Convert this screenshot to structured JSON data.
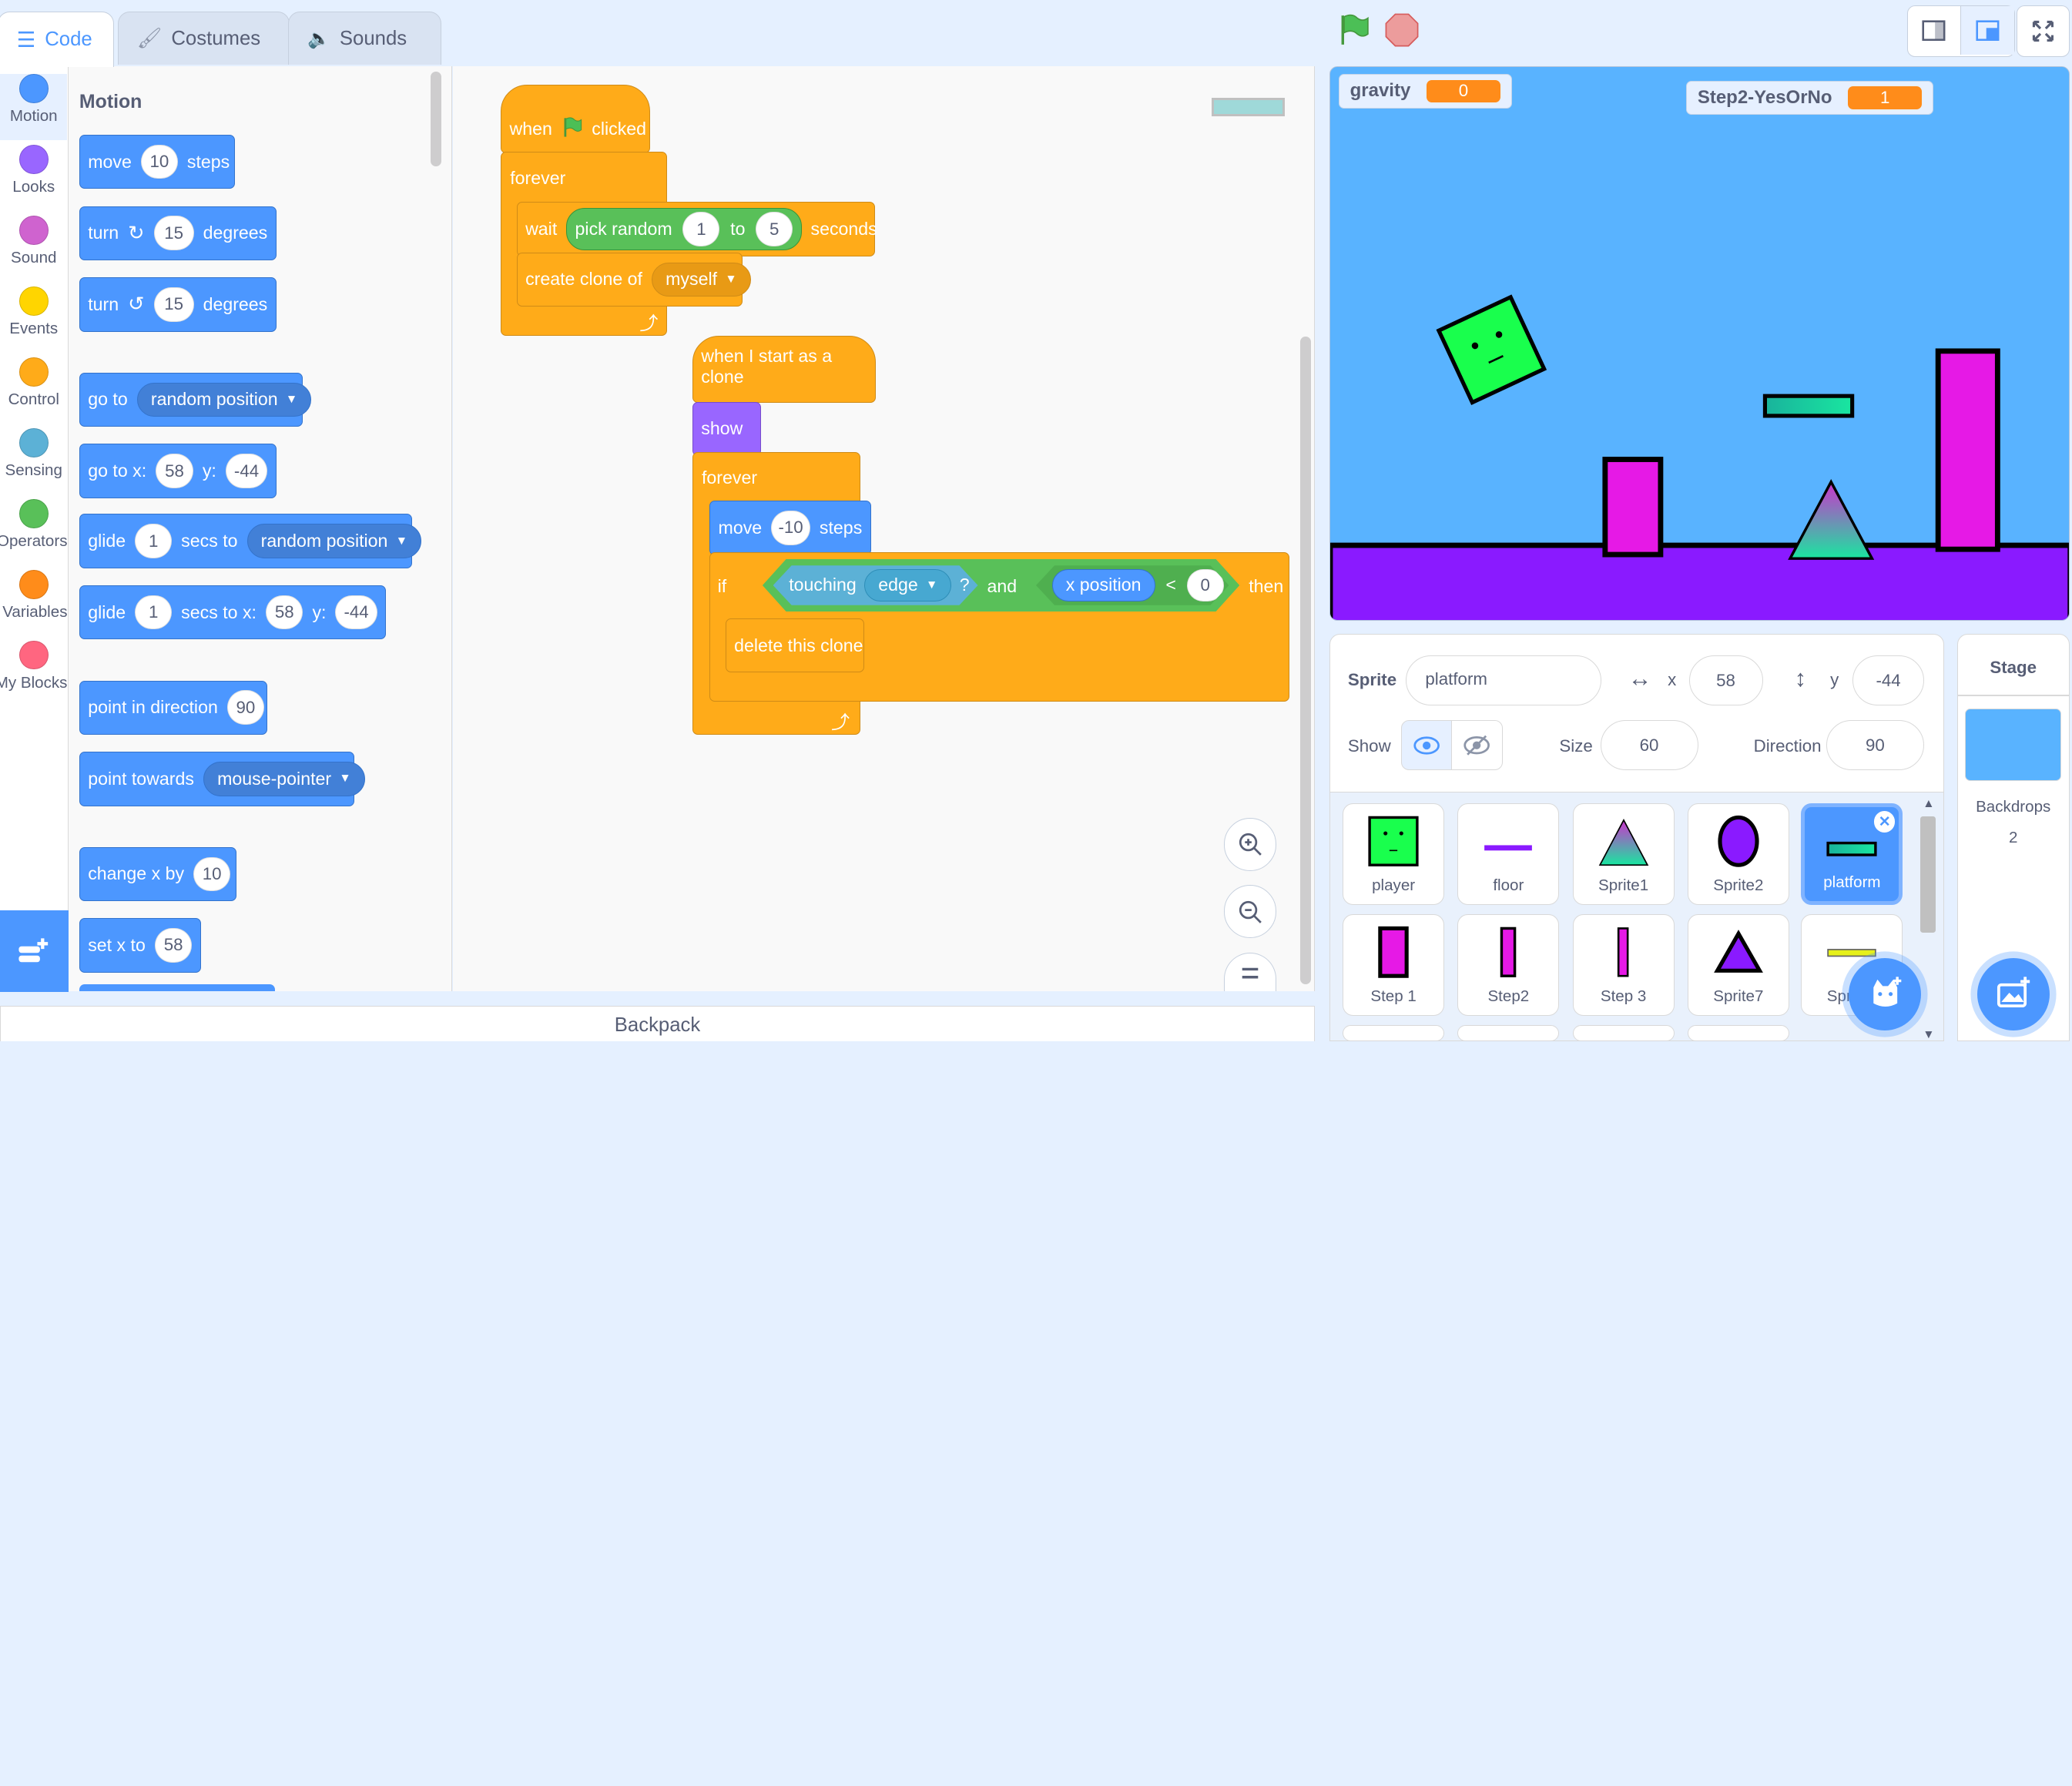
{
  "tabs": {
    "code": "Code",
    "costumes": "Costumes",
    "sounds": "Sounds"
  },
  "categories": [
    {
      "label": "Motion",
      "color": "#4c97ff"
    },
    {
      "label": "Looks",
      "color": "#9966ff"
    },
    {
      "label": "Sound",
      "color": "#cf63cf"
    },
    {
      "label": "Events",
      "color": "#ffd500"
    },
    {
      "label": "Control",
      "color": "#ffab19"
    },
    {
      "label": "Sensing",
      "color": "#5cb1d6"
    },
    {
      "label": "Operators",
      "color": "#59c059"
    },
    {
      "label": "Variables",
      "color": "#ff8c1a"
    },
    {
      "label": "My Blocks",
      "color": "#ff6680"
    }
  ],
  "palette": {
    "heading": "Motion",
    "move": {
      "a": "move",
      "n": "10",
      "b": "steps"
    },
    "turn_right": {
      "a": "turn",
      "n": "15",
      "b": "degrees"
    },
    "turn_left": {
      "a": "turn",
      "n": "15",
      "b": "degrees"
    },
    "goto": {
      "a": "go to",
      "d": "random position"
    },
    "gotoxy": {
      "a": "go to x:",
      "x": "58",
      "y_label": "y:",
      "y": "-44"
    },
    "glide": {
      "a": "glide",
      "n": "1",
      "b": "secs to",
      "d": "random position"
    },
    "glidexy": {
      "a": "glide",
      "n": "1",
      "b": "secs to x:",
      "x": "58",
      "y_label": "y:",
      "y": "-44"
    },
    "point_dir": {
      "a": "point in direction",
      "n": "90"
    },
    "point_towards": {
      "a": "point towards",
      "d": "mouse-pointer"
    },
    "change_x": {
      "a": "change x by",
      "n": "10"
    },
    "set_x": {
      "a": "set x to",
      "n": "58"
    }
  },
  "script1": {
    "when": "when",
    "clicked": "clicked",
    "forever": "forever",
    "wait": "wait",
    "pick_random": "pick random",
    "from": "1",
    "to_label": "to",
    "to": "5",
    "seconds": "seconds",
    "create_clone": "create clone of",
    "clone_target": "myself"
  },
  "script2": {
    "hat": "when I start as a clone",
    "show": "show",
    "forever": "forever",
    "move": "move",
    "move_n": "-10",
    "steps": "steps",
    "if": "if",
    "touching": "touching",
    "edge": "edge",
    "q": "?",
    "and": "and",
    "xpos": "x position",
    "lt": "<",
    "zero": "0",
    "then": "then",
    "delete": "delete this clone"
  },
  "backpack": "Backpack",
  "monitors": {
    "gravity_label": "gravity",
    "gravity_value": "0",
    "step_label": "Step2-YesOrNo",
    "step_value": "1"
  },
  "sprite_info": {
    "sprite_label": "Sprite",
    "sprite_name": "platform",
    "x_label": "x",
    "x": "58",
    "y_label": "y",
    "y": "-44",
    "show_label": "Show",
    "size_label": "Size",
    "size": "60",
    "direction_label": "Direction",
    "direction": "90"
  },
  "sprites": [
    "player",
    "floor",
    "Sprite1",
    "Sprite2",
    "platform",
    "Step 1",
    "Step2",
    "Step 3",
    "Sprite7",
    "Sprite8"
  ],
  "stage_panel": {
    "title": "Stage",
    "backdrops_label": "Backdrops",
    "backdrops_count": "2"
  },
  "colors": {
    "accent": "#4c97ff",
    "stage_sky": "#59b3ff",
    "floor": "#8a1aff",
    "magenta": "#e619e6"
  }
}
